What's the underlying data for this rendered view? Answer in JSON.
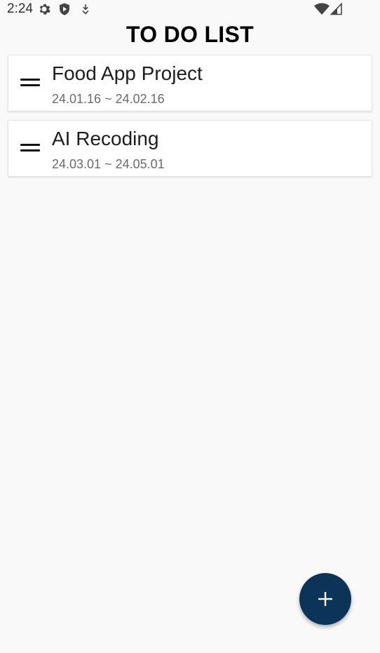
{
  "status_bar": {
    "time": "2:24",
    "left_icons": [
      "settings-icon",
      "play-protect-icon",
      "download-icon"
    ],
    "right_icons": [
      "wifi-icon",
      "cell-signal-icon"
    ]
  },
  "page": {
    "title": "TO DO LIST"
  },
  "tasks": [
    {
      "title": "Food App Project",
      "dates": "24.01.16 ~ 24.02.16"
    },
    {
      "title": "AI Recoding",
      "dates": "24.03.01 ~ 24.05.01"
    }
  ],
  "fab": {
    "icon": "plus-icon",
    "color": "#0c3358"
  },
  "colors": {
    "background": "#f9f9f9",
    "card": "#ffffff",
    "accent": "#0c3358",
    "date_text": "#6b6b6b"
  }
}
